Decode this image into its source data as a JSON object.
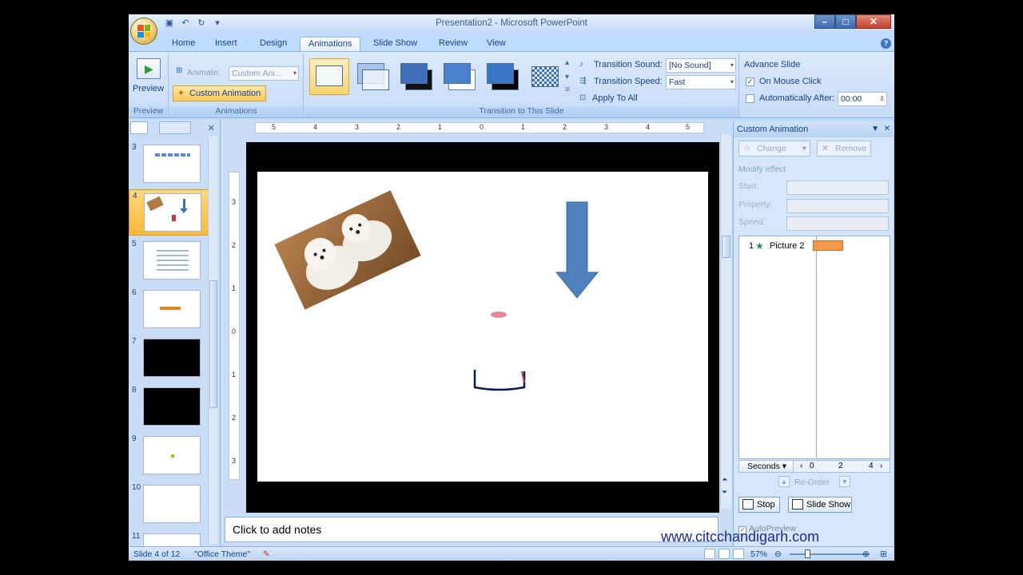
{
  "window": {
    "title": "Presentation2 - Microsoft PowerPoint",
    "controls": [
      "–",
      "□",
      "✕"
    ]
  },
  "quick_access": {
    "icons": [
      "save-icon",
      "undo-icon",
      "redo-icon",
      "customize-icon"
    ]
  },
  "tabs": [
    "Home",
    "Insert",
    "Design",
    "Animations",
    "Slide Show",
    "Review",
    "View"
  ],
  "active_tab": "Animations",
  "ribbon": {
    "preview_group": {
      "button_label": "Preview",
      "group_label": "Preview"
    },
    "animations_group": {
      "animate_label": "Animate:",
      "animate_value": "Custom Ani...",
      "custom_animation_label": "Custom Animation",
      "group_label": "Animations"
    },
    "transition_group": {
      "group_label": "Transition to This Slide",
      "sound_label": "Transition Sound:",
      "sound_value": "[No Sound]",
      "speed_label": "Transition Speed:",
      "speed_value": "Fast",
      "apply_all_label": "Apply To All"
    },
    "advance_group": {
      "title": "Advance Slide",
      "on_mouse_click_label": "On Mouse Click",
      "on_mouse_click_checked": true,
      "auto_after_label": "Automatically After:",
      "auto_after_checked": false,
      "auto_after_value": "00:00"
    }
  },
  "slides_panel": {
    "slides": [
      {
        "num": "3",
        "theme": "light"
      },
      {
        "num": "4",
        "theme": "light",
        "selected": true
      },
      {
        "num": "5",
        "theme": "light"
      },
      {
        "num": "6",
        "theme": "light"
      },
      {
        "num": "7",
        "theme": "dark"
      },
      {
        "num": "8",
        "theme": "dark"
      },
      {
        "num": "9",
        "theme": "light"
      },
      {
        "num": "10",
        "theme": "light"
      },
      {
        "num": "11",
        "theme": "light"
      }
    ]
  },
  "ruler": {
    "h_labels": [
      "5",
      "4",
      "3",
      "2",
      "1",
      "0",
      "1",
      "2",
      "3",
      "4",
      "5"
    ],
    "v_labels": [
      "3",
      "2",
      "1",
      "0",
      "1",
      "2",
      "3"
    ]
  },
  "notes": {
    "placeholder": "Click to add notes"
  },
  "task_pane": {
    "title": "Custom Animation",
    "change_label": "Change",
    "remove_label": "Remove",
    "modify_effect_label": "Modify effect",
    "start_label": "Start:",
    "property_label": "Property:",
    "speed_label": "Speed:",
    "animation_items": [
      {
        "num": "1",
        "label": "Picture 2"
      }
    ],
    "timeline": {
      "unit_label": "Seconds",
      "marks": [
        "0",
        "2",
        "4"
      ]
    },
    "reorder_label": "Re-Order",
    "stop_label": "Stop",
    "slide_show_label": "Slide Show",
    "autopreview_label": "AutoPreview",
    "autopreview_checked": true
  },
  "status_bar": {
    "slide_info": "Slide 4 of 12",
    "theme": "\"Office Theme\"",
    "zoom": "57%"
  },
  "watermark": "www.citcchandigarh.com"
}
